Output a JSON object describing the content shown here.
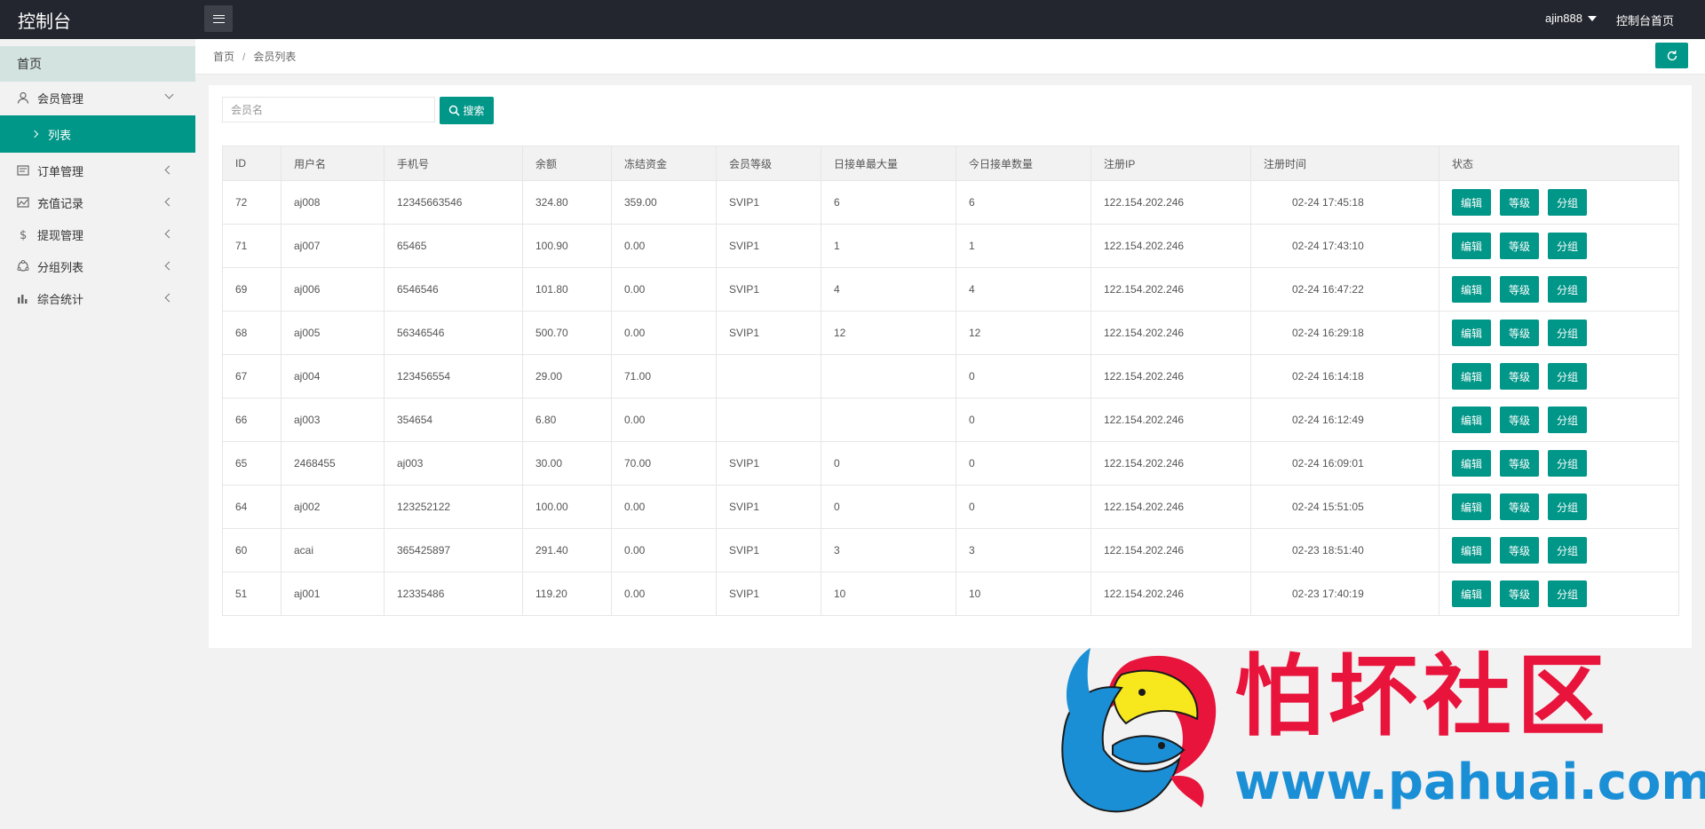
{
  "header": {
    "brand": "控制台",
    "menu_toggle": "menu-icon",
    "username": "ajin888",
    "home_link": "控制台首页"
  },
  "sidebar": {
    "home": "首页",
    "items": [
      {
        "label": "会员管理",
        "icon": "user-icon",
        "expanded": true
      },
      {
        "label": "订单管理",
        "icon": "order-icon"
      },
      {
        "label": "充值记录",
        "icon": "recharge-icon"
      },
      {
        "label": "提现管理",
        "icon": "dollar-icon"
      },
      {
        "label": "分组列表",
        "icon": "group-icon"
      },
      {
        "label": "综合统计",
        "icon": "chart-icon"
      }
    ],
    "active_sub": "列表"
  },
  "breadcrumb": {
    "home": "首页",
    "separator": "/",
    "current": "会员列表"
  },
  "search": {
    "placeholder": "会员名",
    "button": "搜索"
  },
  "table": {
    "headers": [
      "ID",
      "用户名",
      "手机号",
      "余额",
      "冻结资金",
      "会员等级",
      "日接单最大量",
      "今日接单数量",
      "注册IP",
      "注册时间",
      "状态"
    ],
    "actions": [
      "编辑",
      "等级",
      "分组"
    ],
    "rows": [
      [
        "72",
        "aj008",
        "12345663546",
        "324.80",
        "359.00",
        "SVIP1",
        "6",
        "6",
        "122.154.202.246",
        "02-24 17:45:18"
      ],
      [
        "71",
        "aj007",
        "65465",
        "100.90",
        "0.00",
        "SVIP1",
        "1",
        "1",
        "122.154.202.246",
        "02-24 17:43:10"
      ],
      [
        "69",
        "aj006",
        "6546546",
        "101.80",
        "0.00",
        "SVIP1",
        "4",
        "4",
        "122.154.202.246",
        "02-24 16:47:22"
      ],
      [
        "68",
        "aj005",
        "56346546",
        "500.70",
        "0.00",
        "SVIP1",
        "12",
        "12",
        "122.154.202.246",
        "02-24 16:29:18"
      ],
      [
        "67",
        "aj004",
        "123456554",
        "29.00",
        "71.00",
        "",
        "",
        "0",
        "122.154.202.246",
        "02-24 16:14:18"
      ],
      [
        "66",
        "aj003",
        "354654",
        "6.80",
        "0.00",
        "",
        "",
        "0",
        "122.154.202.246",
        "02-24 16:12:49"
      ],
      [
        "65",
        "2468455",
        "aj003",
        "30.00",
        "70.00",
        "SVIP1",
        "0",
        "0",
        "122.154.202.246",
        "02-24 16:09:01"
      ],
      [
        "64",
        "aj002",
        "123252122",
        "100.00",
        "0.00",
        "SVIP1",
        "0",
        "0",
        "122.154.202.246",
        "02-24 15:51:05"
      ],
      [
        "60",
        "acai",
        "365425897",
        "291.40",
        "0.00",
        "SVIP1",
        "3",
        "3",
        "122.154.202.246",
        "02-23 18:51:40"
      ],
      [
        "51",
        "aj001",
        "12335486",
        "119.20",
        "0.00",
        "SVIP1",
        "10",
        "10",
        "122.154.202.246",
        "02-23 17:40:19"
      ]
    ]
  },
  "watermark": {
    "title": "怕坏社区",
    "url": "www.pahuai.com"
  },
  "colors": {
    "accent": "#009688",
    "topbar": "#23262e",
    "watermark_red": "#e8143c",
    "watermark_blue": "#1a8fd6"
  }
}
